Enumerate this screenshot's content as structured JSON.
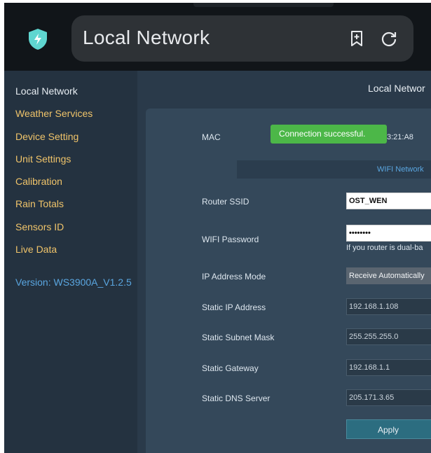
{
  "browser": {
    "url_title": "Local Network"
  },
  "sidebar": {
    "items": [
      {
        "label": "Local Network"
      },
      {
        "label": "Weather Services"
      },
      {
        "label": "Device Setting"
      },
      {
        "label": "Unit Settings"
      },
      {
        "label": "Calibration"
      },
      {
        "label": "Rain Totals"
      },
      {
        "label": "Sensors ID"
      },
      {
        "label": "Live Data"
      }
    ],
    "version": "Version: WS3900A_V1.2.5"
  },
  "main": {
    "title": "Local Networ",
    "mac_label": "MAC",
    "mac_value": "3:21:A8",
    "wifi_section": "WIFI Network",
    "router_ssid_label": "Router SSID",
    "router_ssid_value": "OST_WEN",
    "wifi_password_label": "WIFI Password",
    "wifi_password_value": "••••••••",
    "wifi_hint": "If you router is dual-ba",
    "ip_mode_label": "IP Address Mode",
    "ip_mode_value": "Receive Automatically",
    "static_ip_label": "Static IP Address",
    "static_ip_value": "192.168.1.108",
    "subnet_label": "Static Subnet Mask",
    "subnet_value": "255.255.255.0",
    "gateway_label": "Static Gateway",
    "gateway_value": "192.168.1.1",
    "dns_label": "Static DNS Server",
    "dns_value": "205.171.3.65",
    "apply_label": "Apply"
  },
  "toast": {
    "message": "Connection successful."
  },
  "colors": {
    "accent_link": "#5aa6e0",
    "sidebar_link": "#f0c46a",
    "toast_bg": "#4cb748"
  }
}
